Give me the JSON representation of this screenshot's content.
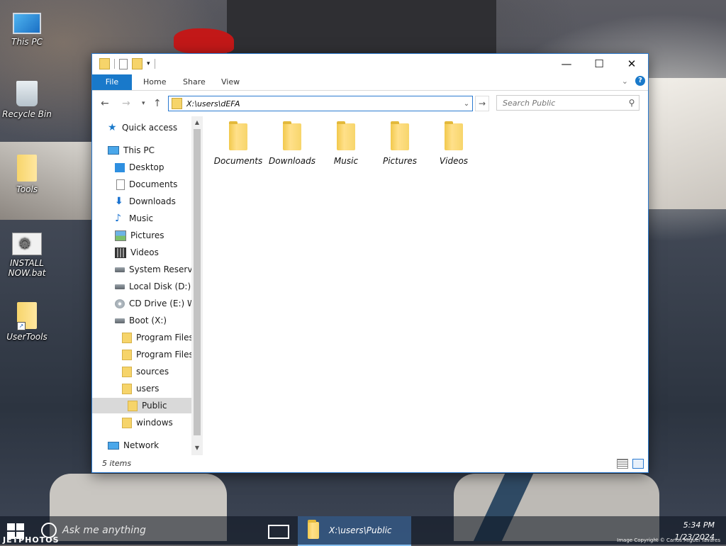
{
  "desktop": {
    "icons": [
      {
        "label": "This PC"
      },
      {
        "label": "Recycle Bin"
      },
      {
        "label": "Tools"
      },
      {
        "label": "INSTALL NOW.bat"
      },
      {
        "label": "UserTools"
      }
    ]
  },
  "window": {
    "ribbon_tabs": {
      "file": "File",
      "home": "Home",
      "share": "Share",
      "view": "View"
    },
    "address": "X:\\users\\dEFA",
    "search_placeholder": "Search Public",
    "nav_items": [
      {
        "label": "Quick access",
        "icon": "star-icon"
      },
      {
        "label": "This PC",
        "icon": "computer-icon"
      },
      {
        "label": "Desktop",
        "icon": "desktop-icon"
      },
      {
        "label": "Documents",
        "icon": "documents-icon"
      },
      {
        "label": "Downloads",
        "icon": "download-arrow-icon"
      },
      {
        "label": "Music",
        "icon": "music-note-icon"
      },
      {
        "label": "Pictures",
        "icon": "pictures-icon"
      },
      {
        "label": "Videos",
        "icon": "film-icon"
      },
      {
        "label": "System Reserved",
        "icon": "drive-icon"
      },
      {
        "label": "Local Disk (D:)",
        "icon": "drive-icon"
      },
      {
        "label": "CD Drive (E:) Wi",
        "icon": "cd-drive-icon"
      },
      {
        "label": "Boot (X:)",
        "icon": "drive-icon"
      },
      {
        "label": "Program Files",
        "icon": "folder-icon"
      },
      {
        "label": "Program Files (",
        "icon": "folder-icon"
      },
      {
        "label": "sources",
        "icon": "folder-icon"
      },
      {
        "label": "users",
        "icon": "folder-icon"
      },
      {
        "label": "Public",
        "icon": "folder-icon",
        "selected": true
      },
      {
        "label": "windows",
        "icon": "folder-icon"
      },
      {
        "label": "Network",
        "icon": "network-icon"
      }
    ],
    "files": [
      {
        "label": "Documents"
      },
      {
        "label": "Downloads"
      },
      {
        "label": "Music"
      },
      {
        "label": "Pictures"
      },
      {
        "label": "Videos"
      }
    ],
    "status": "5 items"
  },
  "taskbar": {
    "search_text": "Ask me anything",
    "active_app": "X:\\users\\Public",
    "time": "5:34 PM",
    "date": "1/23/2024"
  },
  "watermark": {
    "left": "JETPHOTOS",
    "right": "Image Copyright © Carlos Miguel Tavares"
  }
}
